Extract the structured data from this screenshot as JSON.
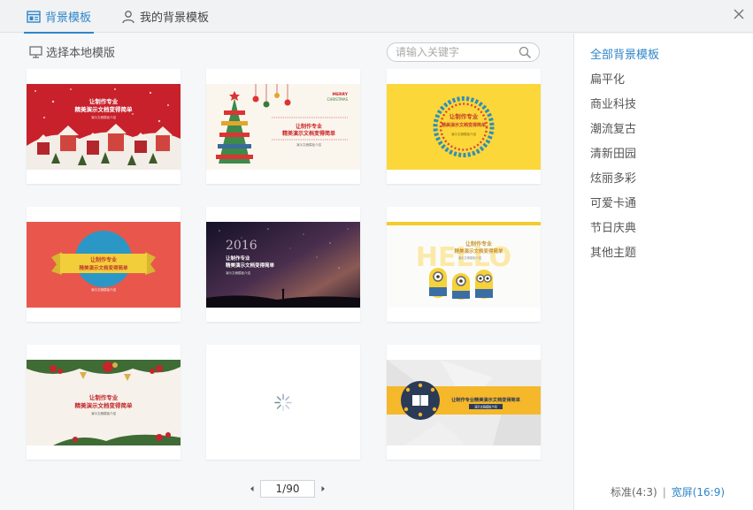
{
  "tabs": [
    {
      "label": "背景模板",
      "active": true
    },
    {
      "label": "我的背景模板",
      "active": false
    }
  ],
  "toolbar": {
    "local_label": "选择本地模版",
    "search_placeholder": "请输入关键字",
    "search_value": ""
  },
  "thumb_text": {
    "line1": "让制作专业",
    "line2": "精美演示文档变得简单",
    "line_combined": "让制作专业精美演示文档变得简单",
    "sub": "演示文稿模板介绍",
    "year": "2016",
    "merry": "MERRY",
    "christmas": "CHRISTMAS",
    "hello": "HELLO"
  },
  "templates": [
    {
      "name": "red-christmas-village"
    },
    {
      "name": "christmas-tree"
    },
    {
      "name": "yellow-circle"
    },
    {
      "name": "red-ribbon"
    },
    {
      "name": "starry-sky-2016"
    },
    {
      "name": "minions"
    },
    {
      "name": "holly-wreath"
    },
    {
      "name": "loading"
    },
    {
      "name": "grey-banner-icons"
    }
  ],
  "pagination": {
    "current": 1,
    "total": 90,
    "label": "1/90"
  },
  "sidebar": {
    "categories": [
      {
        "label": "全部背景模板",
        "active": true
      },
      {
        "label": "扁平化",
        "active": false
      },
      {
        "label": "商业科技",
        "active": false
      },
      {
        "label": "潮流复古",
        "active": false
      },
      {
        "label": "清新田园",
        "active": false
      },
      {
        "label": "炫丽多彩",
        "active": false
      },
      {
        "label": "可爱卡通",
        "active": false
      },
      {
        "label": "节日庆典",
        "active": false
      },
      {
        "label": "其他主题",
        "active": false
      }
    ],
    "ratio_standard": "标准(4:3)",
    "ratio_sep": "|",
    "ratio_wide": "宽屏(16:9)",
    "ratio_selected": "宽屏(16:9)"
  },
  "colors": {
    "accent": "#2f86c9",
    "red_bg": "#c8212b",
    "yellow_bg": "#fbd73a",
    "coral_bg": "#e9574c",
    "night_bg": "#1f1a2e"
  },
  "icons": {
    "tab1": "template-icon",
    "tab2": "user-icon",
    "close": "close-icon",
    "local": "monitor-icon",
    "search": "search-icon",
    "prev": "triangle-left-icon",
    "next": "triangle-right-icon"
  }
}
